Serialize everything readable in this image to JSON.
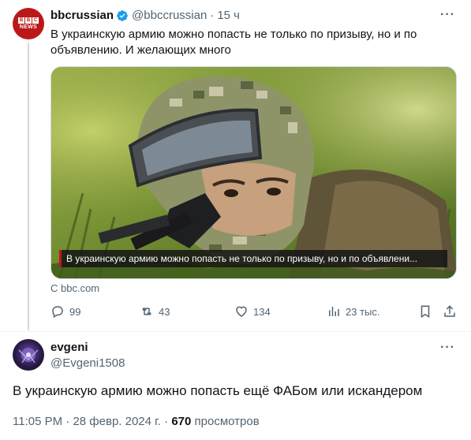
{
  "tweet1": {
    "avatar_text_top": "BBC",
    "avatar_text_bottom": "NEWS",
    "display_name": "bbcrussian",
    "handle": "@bbccrussian",
    "separator": "·",
    "time": "15 ч",
    "text": "В украинскую армию можно попасть не только по призыву, но и по объявлению. И желающих много",
    "media_caption": "В украинскую армию можно попасть не только по призыву, но и по объявлени...",
    "source": "С bbc.com",
    "replies": "99",
    "retweets": "43",
    "likes": "134",
    "views": "23 тыс."
  },
  "tweet2": {
    "display_name": "evgeni",
    "handle": "@Evgeni1508",
    "text": "В украинскую армию можно попасть ещё ФАБом или искандером",
    "time": "11:05 PM",
    "date": "28 февр. 2024 г.",
    "separator": "·",
    "views_count": "670",
    "views_label": "просмотров"
  },
  "colors": {
    "bbc_red": "#bb1919",
    "verified_blue": "#1d9bf0",
    "secondary_text": "#536471"
  }
}
